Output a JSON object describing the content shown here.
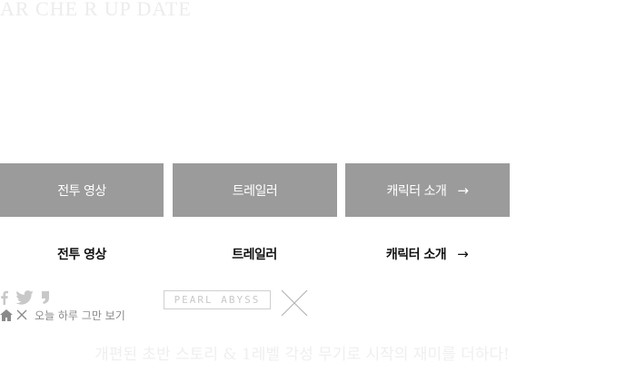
{
  "header": {
    "title": "AR CHE R UP DATE"
  },
  "tabs": [
    {
      "label": "전투 영상",
      "arrow": ""
    },
    {
      "label": "트레일러",
      "arrow": ""
    },
    {
      "label": "캐릭터 소개",
      "arrow": "→"
    }
  ],
  "labels": [
    {
      "label": "전투 영상",
      "arrow": ""
    },
    {
      "label": "트레일러",
      "arrow": ""
    },
    {
      "label": "캐릭터 소개",
      "arrow": "→"
    }
  ],
  "social": [
    "facebook-icon",
    "twitter-icon",
    "quote-icon"
  ],
  "logo": {
    "text": "PEARL ABYSS"
  },
  "footer": {
    "dismiss_label": "오늘 하루 그만 보기"
  },
  "tagline": "개편된 초반 스토리 & 1레벨 각성 무기로 시작의 재미를 더하다!",
  "colors": {
    "tab_bg": "#9b9b9b",
    "tab_text": "#ffffff",
    "muted": "#c8c8c8"
  }
}
